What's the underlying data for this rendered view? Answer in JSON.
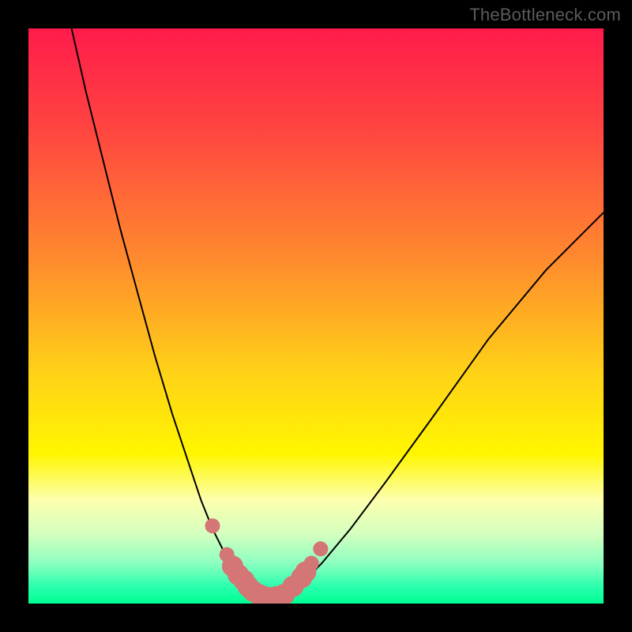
{
  "watermark": "TheBottleneck.com",
  "colors": {
    "black": "#000000",
    "curve": "#000000",
    "marker_fill": "#d47676",
    "marker_stroke": "#d47676",
    "gradient_stops": [
      {
        "offset": 0.0,
        "color": "#ff1b4b"
      },
      {
        "offset": 0.18,
        "color": "#ff4640"
      },
      {
        "offset": 0.4,
        "color": "#ff8a2e"
      },
      {
        "offset": 0.6,
        "color": "#ffd217"
      },
      {
        "offset": 0.74,
        "color": "#fff600"
      },
      {
        "offset": 0.82,
        "color": "#fdffae"
      },
      {
        "offset": 0.88,
        "color": "#d3ffbf"
      },
      {
        "offset": 0.93,
        "color": "#8cffc0"
      },
      {
        "offset": 0.97,
        "color": "#2bffae"
      },
      {
        "offset": 1.0,
        "color": "#00ff94"
      }
    ]
  },
  "chart_data": {
    "type": "line",
    "title": "",
    "xlabel": "",
    "ylabel": "",
    "xlim": [
      0,
      1
    ],
    "ylim": [
      0,
      1
    ],
    "series": [
      {
        "name": "bottleneck-curve",
        "x": [
          0.075,
          0.1,
          0.13,
          0.16,
          0.19,
          0.22,
          0.25,
          0.28,
          0.3,
          0.32,
          0.34,
          0.36,
          0.38,
          0.4,
          0.42,
          0.44,
          0.47,
          0.51,
          0.56,
          0.62,
          0.7,
          0.8,
          0.9,
          1.0
        ],
        "y": [
          1.0,
          0.89,
          0.77,
          0.65,
          0.54,
          0.43,
          0.33,
          0.24,
          0.18,
          0.13,
          0.09,
          0.06,
          0.03,
          0.015,
          0.01,
          0.015,
          0.03,
          0.07,
          0.13,
          0.21,
          0.32,
          0.46,
          0.58,
          0.68
        ]
      }
    ],
    "markers": {
      "name": "highlight-dots",
      "points": [
        {
          "x": 0.32,
          "y": 0.135
        },
        {
          "x": 0.345,
          "y": 0.085
        },
        {
          "x": 0.355,
          "y": 0.065
        },
        {
          "x": 0.365,
          "y": 0.05
        },
        {
          "x": 0.375,
          "y": 0.04
        },
        {
          "x": 0.382,
          "y": 0.03
        },
        {
          "x": 0.39,
          "y": 0.022
        },
        {
          "x": 0.4,
          "y": 0.016
        },
        {
          "x": 0.41,
          "y": 0.012
        },
        {
          "x": 0.42,
          "y": 0.01
        },
        {
          "x": 0.432,
          "y": 0.012
        },
        {
          "x": 0.445,
          "y": 0.016
        },
        {
          "x": 0.46,
          "y": 0.03
        },
        {
          "x": 0.475,
          "y": 0.045
        },
        {
          "x": 0.482,
          "y": 0.055
        },
        {
          "x": 0.492,
          "y": 0.07
        },
        {
          "x": 0.508,
          "y": 0.095
        }
      ],
      "radius_small": 9,
      "radius_large": 13
    }
  }
}
